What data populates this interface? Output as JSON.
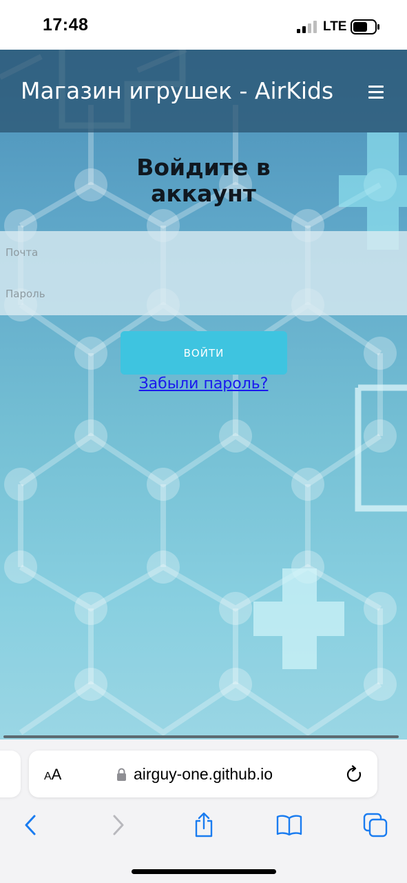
{
  "status_bar": {
    "time": "17:48",
    "network": "LTE",
    "signal_icon": "signal-bars-icon",
    "battery_icon": "battery-icon"
  },
  "header": {
    "title": "Магазин игрушек - AirKids",
    "menu_icon": "hamburger-menu-icon"
  },
  "login": {
    "heading_line1": "Войдите в",
    "heading_line2": "аккаунт",
    "email_placeholder": "Почта",
    "password_placeholder": "Пароль",
    "button_label": "ВОЙТИ",
    "forgot_password": "Забыли пароль?"
  },
  "browser": {
    "text_size_small": "A",
    "text_size_large": "A",
    "url": "airguy-one.github.io",
    "lock_icon": "lock-icon",
    "reload_icon": "reload-icon",
    "nav_icons": [
      "back-chevron-icon",
      "forward-chevron-icon",
      "share-icon",
      "bookmarks-icon",
      "tabs-icon"
    ]
  },
  "colors": {
    "header_bg": "#28506e",
    "button_bg": "#3ec4e0",
    "link": "#1a1aee",
    "ios_blue": "#1a7cf0"
  }
}
